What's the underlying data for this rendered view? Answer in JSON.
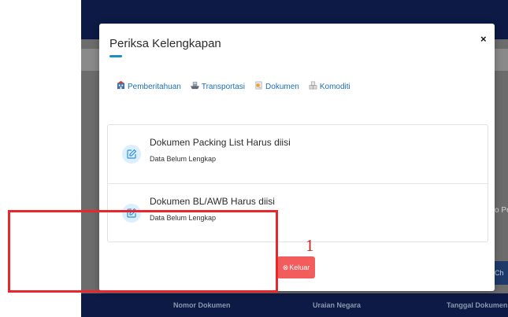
{
  "background": {
    "side_text": "o Pe",
    "side_button": "Ch",
    "footer_columns": [
      "Nomor Dokumen",
      "Uraian Negara",
      "Tanggal Dokumen"
    ]
  },
  "modal": {
    "title": "Periksa Kelengkapan",
    "close_label": "×",
    "tabs": [
      {
        "label": "Pemberitahuan",
        "icon": "building-icon"
      },
      {
        "label": "Transportasi",
        "icon": "ship-icon"
      },
      {
        "label": "Dokumen",
        "icon": "document-icon"
      },
      {
        "label": "Komoditi",
        "icon": "boxes-icon"
      }
    ],
    "items": [
      {
        "title": "Dokumen Packing List Harus diisi",
        "status": "Data Belum Lengkap",
        "icon": "edit-icon"
      },
      {
        "title": "Dokumen BL/AWB Harus diisi",
        "status": "Data Belum Lengkap",
        "icon": "edit-icon"
      }
    ],
    "exit_button": {
      "icon": "⊗",
      "label": "Keluar"
    }
  },
  "annotation": {
    "number": "1"
  },
  "colors": {
    "accent": "#1a8fc9",
    "tab_text": "#1b6fb5",
    "exit_button": "#f25c5c",
    "annotation": "#e8262b",
    "navbar": "#0c1a45",
    "icon_circle": "#dcefff"
  }
}
